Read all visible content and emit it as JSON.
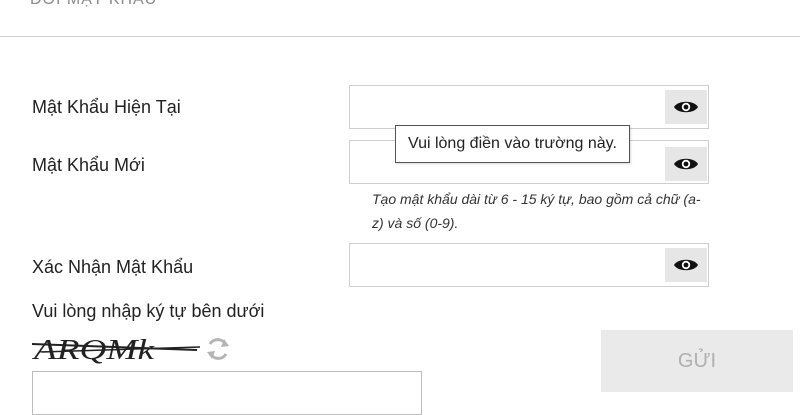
{
  "header": {
    "title": "ĐỔI MẬT KHẨU"
  },
  "form": {
    "current_password": {
      "label": "Mật Khẩu Hiện Tại",
      "value": ""
    },
    "new_password": {
      "label": "Mật Khẩu Mới",
      "value": "",
      "hint": "Tạo mật khẩu dài từ 6 - 15 ký tự, bao gồm cả chữ (a-z) và số (0-9)."
    },
    "confirm_password": {
      "label": "Xác Nhận Mật Khẩu",
      "value": ""
    },
    "tooltip": "Vui lòng điền vào trường này.",
    "captcha": {
      "label": "Vui lòng nhập ký tự bên dưới",
      "text": "ARQMk",
      "value": ""
    },
    "submit_label": "GỬI"
  },
  "icons": {
    "reveal": "eye-icon",
    "refresh": "refresh-icon"
  },
  "colors": {
    "disabled_button_bg": "#eaeaea",
    "disabled_button_text": "#b0b0b0",
    "border": "#cfcfcf"
  }
}
